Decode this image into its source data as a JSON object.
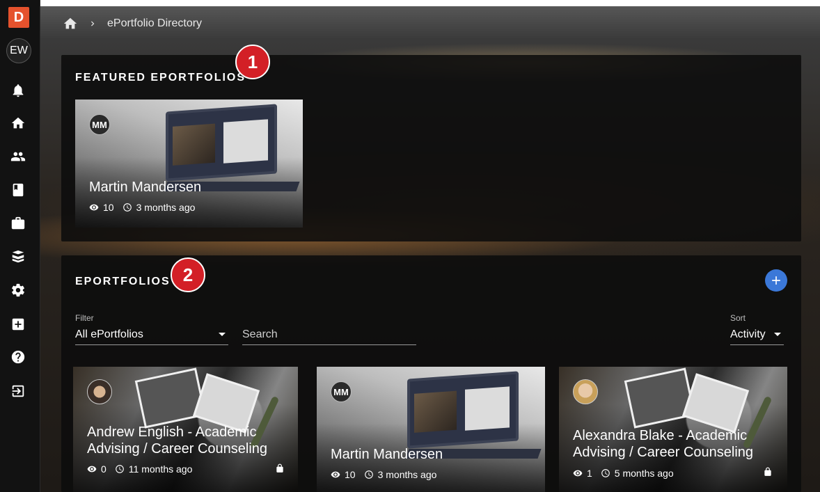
{
  "sidebar": {
    "logo_letter": "D",
    "user_initials": "EW",
    "icons": [
      "bell-icon",
      "home-icon",
      "people-icon",
      "book-icon",
      "briefcase-icon",
      "stack-icon",
      "gear-icon",
      "add-box-icon",
      "help-icon",
      "logout-icon"
    ]
  },
  "breadcrumb": {
    "current": "ePortfolio Directory"
  },
  "featured": {
    "title": "FEATURED EPORTFOLIOS",
    "badge": "1",
    "card": {
      "initials": "MM",
      "name": "Martin Mandersen",
      "views": "10",
      "updated": "3 months ago"
    }
  },
  "eportfolios": {
    "title": "EPORTFOLIOS",
    "badge": "2",
    "filter_label": "Filter",
    "filter_value": "All ePortfolios",
    "search_placeholder": "Search",
    "sort_label": "Sort",
    "sort_value": "Activity",
    "cards": [
      {
        "name_line1": "Andrew English - Academic",
        "name_line2": "Advising / Career Counseling",
        "views": "0",
        "updated": "11 months ago",
        "locked": true
      },
      {
        "initials": "MM",
        "name_line1": "Martin Mandersen",
        "views": "10",
        "updated": "3 months ago",
        "locked": false
      },
      {
        "name_line1": "Alexandra Blake - Academic",
        "name_line2": "Advising / Career Counseling",
        "views": "1",
        "updated": "5 months ago",
        "locked": true
      }
    ]
  },
  "colors": {
    "accent": "#3b78d8",
    "badge": "#d31f26",
    "logo": "#e5522d"
  }
}
